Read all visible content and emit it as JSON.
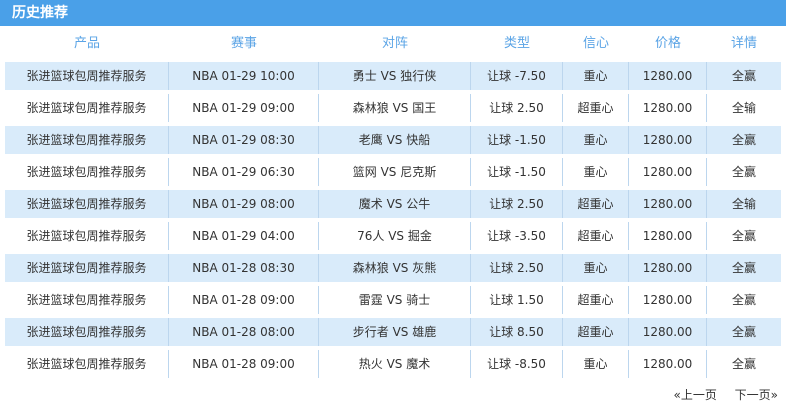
{
  "title": "历史推荐",
  "headers": [
    "产品",
    "赛事",
    "对阵",
    "类型",
    "信心",
    "价格",
    "详情"
  ],
  "rows": [
    {
      "product": "张进篮球包周推荐服务",
      "match": "NBA 01-29 10:00",
      "teams": "勇士 VS 独行侠",
      "type": "让球 -7.50",
      "confidence": "重心",
      "price": "1280.00",
      "result": "全赢"
    },
    {
      "product": "张进篮球包周推荐服务",
      "match": "NBA 01-29 09:00",
      "teams": "森林狼 VS 国王",
      "type": "让球 2.50",
      "confidence": "超重心",
      "price": "1280.00",
      "result": "全输"
    },
    {
      "product": "张进篮球包周推荐服务",
      "match": "NBA 01-29 08:30",
      "teams": "老鹰 VS 快船",
      "type": "让球 -1.50",
      "confidence": "重心",
      "price": "1280.00",
      "result": "全赢"
    },
    {
      "product": "张进篮球包周推荐服务",
      "match": "NBA 01-29 06:30",
      "teams": "篮网 VS 尼克斯",
      "type": "让球 -1.50",
      "confidence": "重心",
      "price": "1280.00",
      "result": "全赢"
    },
    {
      "product": "张进篮球包周推荐服务",
      "match": "NBA 01-29 08:00",
      "teams": "魔术 VS 公牛",
      "type": "让球 2.50",
      "confidence": "超重心",
      "price": "1280.00",
      "result": "全输"
    },
    {
      "product": "张进篮球包周推荐服务",
      "match": "NBA 01-29 04:00",
      "teams": "76人 VS 掘金",
      "type": "让球 -3.50",
      "confidence": "超重心",
      "price": "1280.00",
      "result": "全赢"
    },
    {
      "product": "张进篮球包周推荐服务",
      "match": "NBA 01-28 08:30",
      "teams": "森林狼 VS 灰熊",
      "type": "让球 2.50",
      "confidence": "重心",
      "price": "1280.00",
      "result": "全赢"
    },
    {
      "product": "张进篮球包周推荐服务",
      "match": "NBA 01-28 09:00",
      "teams": "雷霆 VS 骑士",
      "type": "让球 1.50",
      "confidence": "超重心",
      "price": "1280.00",
      "result": "全赢"
    },
    {
      "product": "张进篮球包周推荐服务",
      "match": "NBA 01-28 08:00",
      "teams": "步行者 VS 雄鹿",
      "type": "让球 8.50",
      "confidence": "超重心",
      "price": "1280.00",
      "result": "全赢"
    },
    {
      "product": "张进篮球包周推荐服务",
      "match": "NBA 01-28 09:00",
      "teams": "热火 VS 魔术",
      "type": "让球 -8.50",
      "confidence": "重心",
      "price": "1280.00",
      "result": "全赢"
    }
  ],
  "pager": {
    "prev": "«上一页",
    "next": "下一页»"
  },
  "colors": {
    "title_bg": "#4aa0e8",
    "header_text": "#5ba4e6",
    "row_alt_bg": "#d9ebfa"
  }
}
